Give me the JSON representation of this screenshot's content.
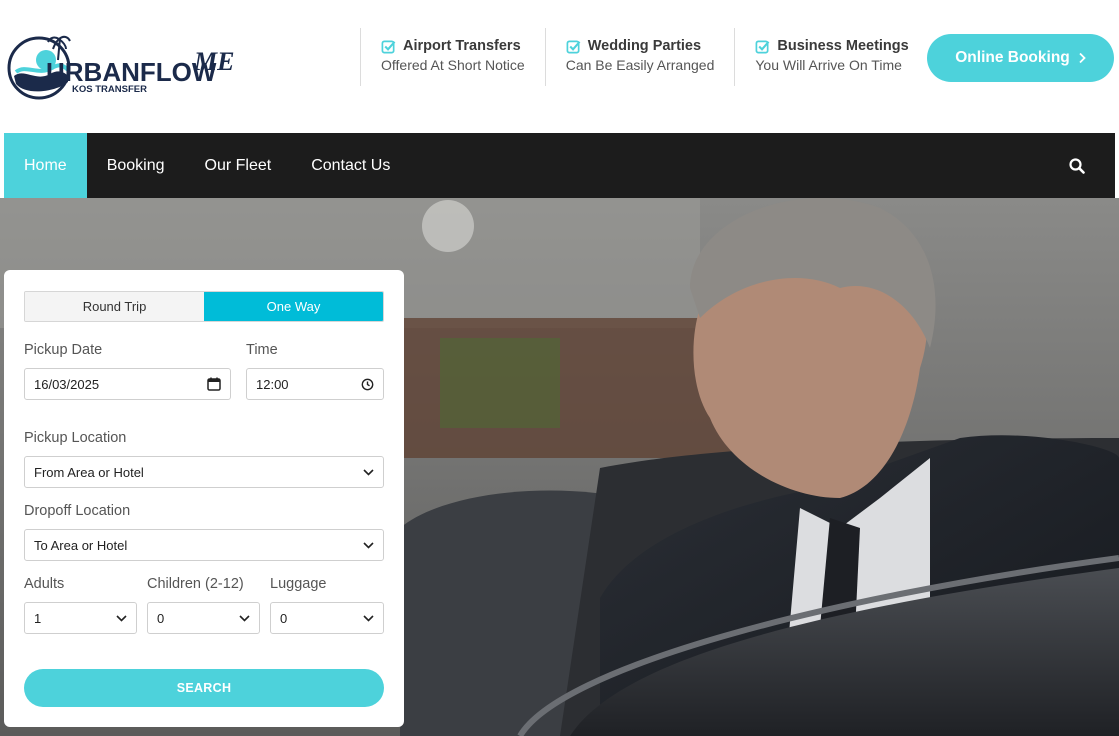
{
  "logo": {
    "brand": "URBANFLOW",
    "mark": "ME",
    "tagline": "KOS TRANSFER"
  },
  "features": [
    {
      "title": "Airport Transfers",
      "subtitle": "Offered At Short Notice",
      "icon": "check-square-icon"
    },
    {
      "title": "Wedding Parties",
      "subtitle": "Can Be Easily Arranged",
      "icon": "check-square-icon"
    },
    {
      "title": "Business Meetings",
      "subtitle": "You Will Arrive On Time",
      "icon": "check-square-icon"
    }
  ],
  "cta": {
    "label": "Online Booking",
    "icon": "chevron-right-icon"
  },
  "nav": {
    "items": [
      {
        "label": "Home",
        "active": true
      },
      {
        "label": "Booking",
        "active": false
      },
      {
        "label": "Our Fleet",
        "active": false
      },
      {
        "label": "Contact Us",
        "active": false
      }
    ],
    "search_icon": "search-icon"
  },
  "booking": {
    "trip_types": [
      {
        "label": "Round Trip",
        "selected": false
      },
      {
        "label": "One Way",
        "selected": true
      }
    ],
    "pickup_date": {
      "label": "Pickup Date",
      "value": "16/03/2025",
      "icon": "calendar-icon"
    },
    "time": {
      "label": "Time",
      "value": "12:00",
      "icon": "clock-icon"
    },
    "pickup_location": {
      "label": "Pickup Location",
      "value": "From Area or Hotel"
    },
    "dropoff_location": {
      "label": "Dropoff Location",
      "value": "To Area or Hotel"
    },
    "adults": {
      "label": "Adults",
      "value": "1"
    },
    "children": {
      "label": "Children (2-12)",
      "value": "0"
    },
    "luggage": {
      "label": "Luggage",
      "value": "0"
    },
    "search_label": "SEARCH"
  },
  "colors": {
    "accent": "#4dd2db",
    "toggle_active": "#00bcd8",
    "nav_bg": "#1c1c1c",
    "logo_navy": "#1b2a4a"
  }
}
